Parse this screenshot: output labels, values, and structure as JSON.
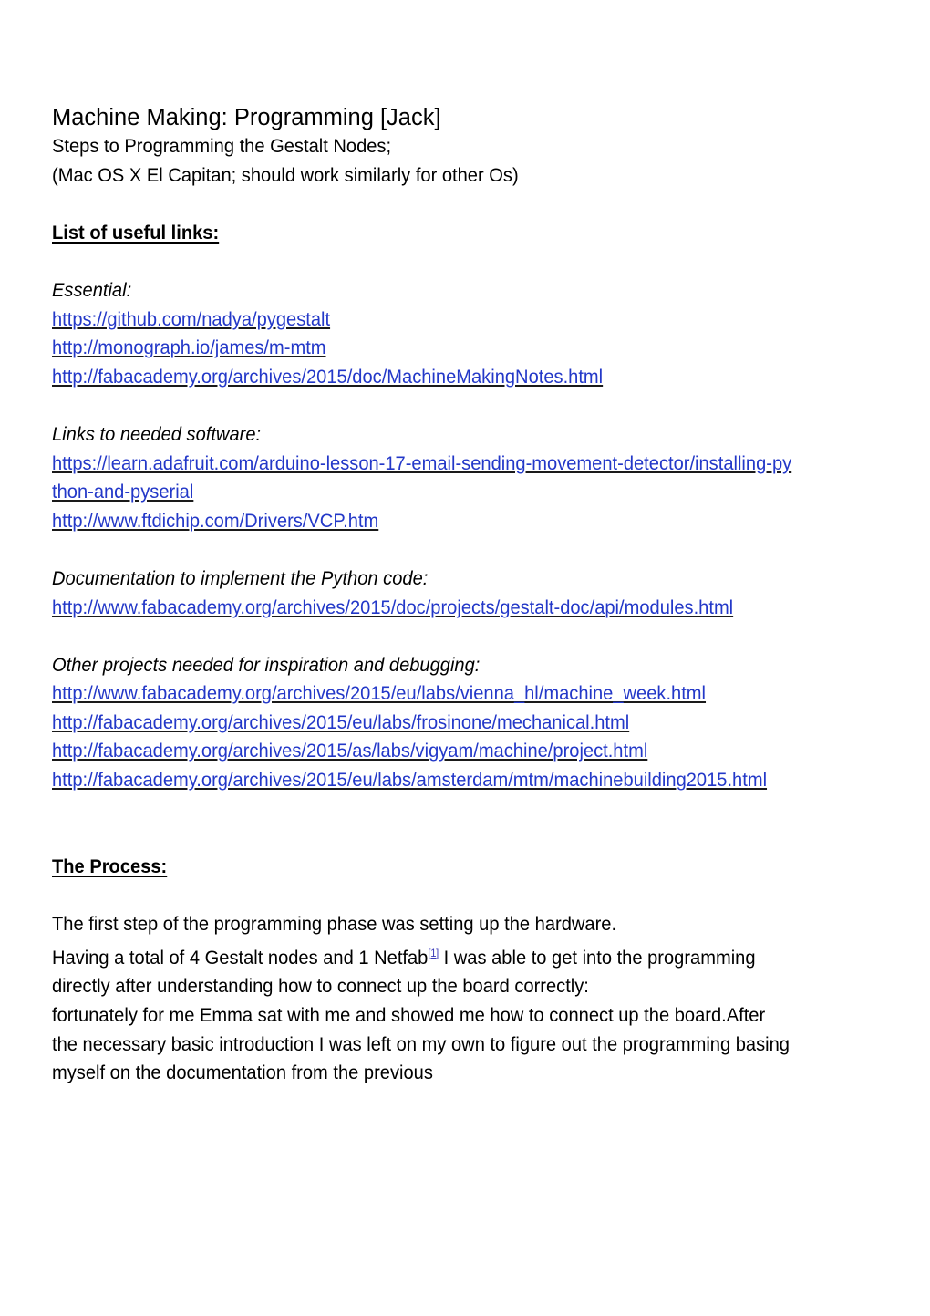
{
  "document": {
    "title": "Machine Making: Programming [Jack]",
    "subtitle_line1": "Steps to Programming the Gestalt Nodes;",
    "subtitle_line2": "(Mac OS X El Capitan; should work similarly for other Os)",
    "sections": {
      "links_heading": "List of useful links:",
      "essential_label": "Essential:",
      "essential_links": [
        "https://github.com/nadya/pygestalt",
        "http://monograph.io/james/m-mtm",
        "http://fabacademy.org/archives/2015/doc/MachineMakingNotes.html"
      ],
      "software_label": "Links to needed software:",
      "software_links": [
        "https://learn.adafruit.com/arduino-lesson-17-email-sending-movement-detector/installing-python-and-pyserial",
        "http://www.ftdichip.com/Drivers/VCP.htm"
      ],
      "documentation_label": "Documentation to implement the Python code:",
      "documentation_links": [
        "http://www.fabacademy.org/archives/2015/doc/projects/gestalt-doc/api/modules.html"
      ],
      "other_projects_label": "Other projects needed for inspiration and debugging:",
      "other_projects_links": [
        "http://www.fabacademy.org/archives/2015/eu/labs/vienna_hl/machine_week.html",
        "http://fabacademy.org/archives/2015/eu/labs/frosinone/mechanical.html",
        "http://fabacademy.org/archives/2015/as/labs/vigyam/machine/project.html",
        "http://fabacademy.org/archives/2015/eu/labs/amsterdam/mtm/machinebuilding2015.html"
      ],
      "process_heading": "The Process:",
      "process_paragraphs": [
        "The first step of the programming phase was setting up the hardware.",
        "Having a total of 4 Gestalt nodes and 1 Netfab",
        " I was able to get into the programming directly after understanding how to connect up the board correctly:",
        "fortunately for me Emma sat with me and showed me how to connect up the board.After the necessary basic introduction I was left on my own to figure out the programming basing myself on the documentation from the previous"
      ],
      "footnote_marker": "[1]"
    },
    "colors": {
      "link": "#2338C8",
      "text": "#000000",
      "footnote": "#3b3bb8",
      "background": "#ffffff"
    }
  }
}
